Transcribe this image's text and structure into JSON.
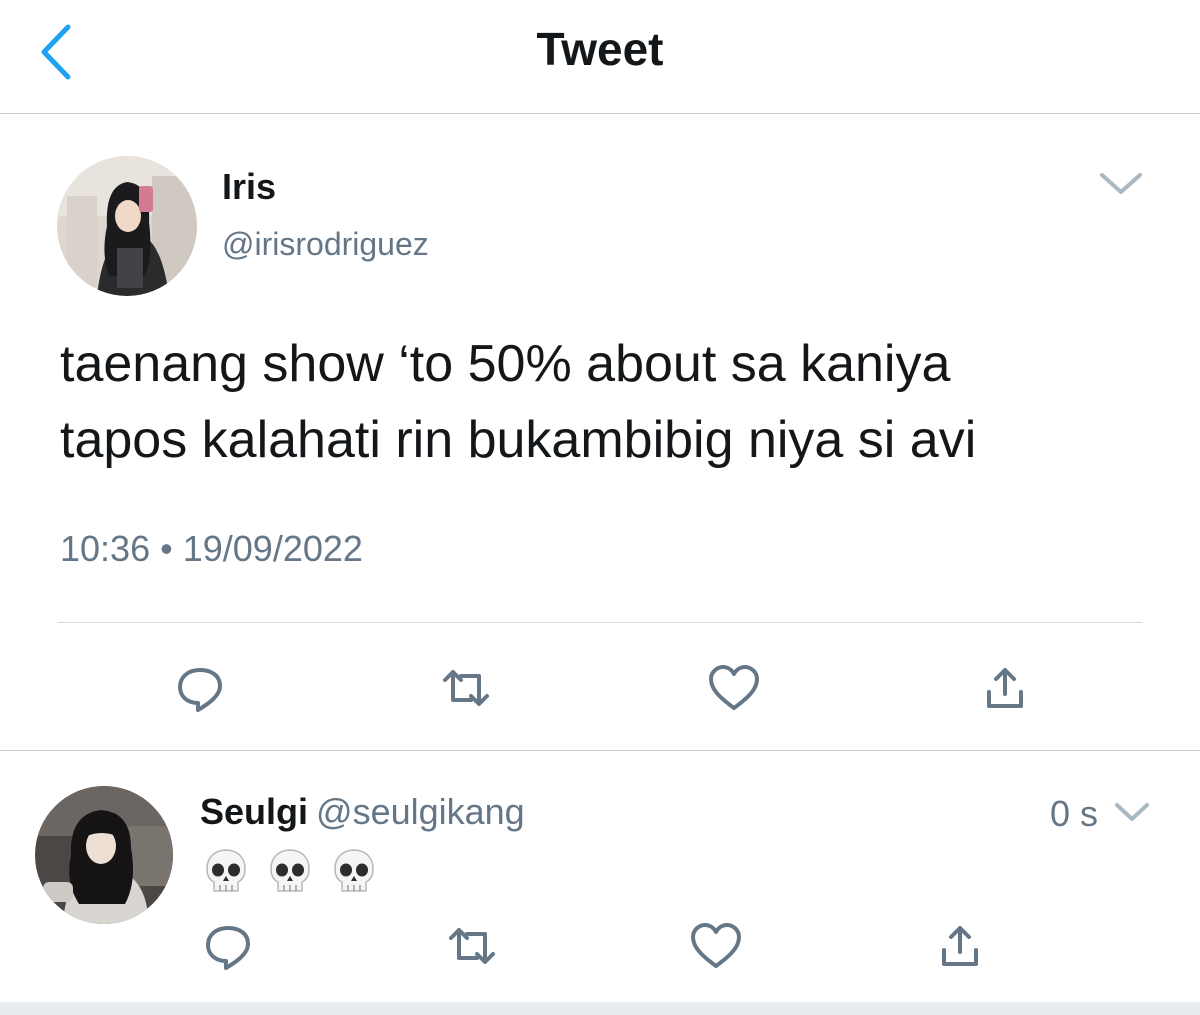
{
  "header": {
    "title": "Tweet",
    "back_icon": "chevron-left-icon",
    "accent_color": "#1da1f2"
  },
  "main_tweet": {
    "author_name": "Iris",
    "author_handle": "@irisrodriguez",
    "text_line1": "taenang show ‘to 50% about sa kaniya",
    "text_line2": "tapos kalahati rin bukambibig niya si avi",
    "time": "10:36",
    "separator": "•",
    "date": "19/09/2022",
    "actions": [
      "reply-icon",
      "retweet-icon",
      "like-icon",
      "share-icon"
    ]
  },
  "reply": {
    "author_name": "Seulgi",
    "author_handle": "@seulgikang",
    "time_ago": "0 s",
    "emojis": [
      "skull-emoji",
      "skull-emoji",
      "skull-emoji"
    ],
    "actions": [
      "reply-icon",
      "retweet-icon",
      "like-icon",
      "share-icon"
    ]
  },
  "colors": {
    "text_primary": "#14171a",
    "text_secondary": "#657786",
    "icon_gray": "#657786",
    "divider": "#c9cfd4"
  }
}
